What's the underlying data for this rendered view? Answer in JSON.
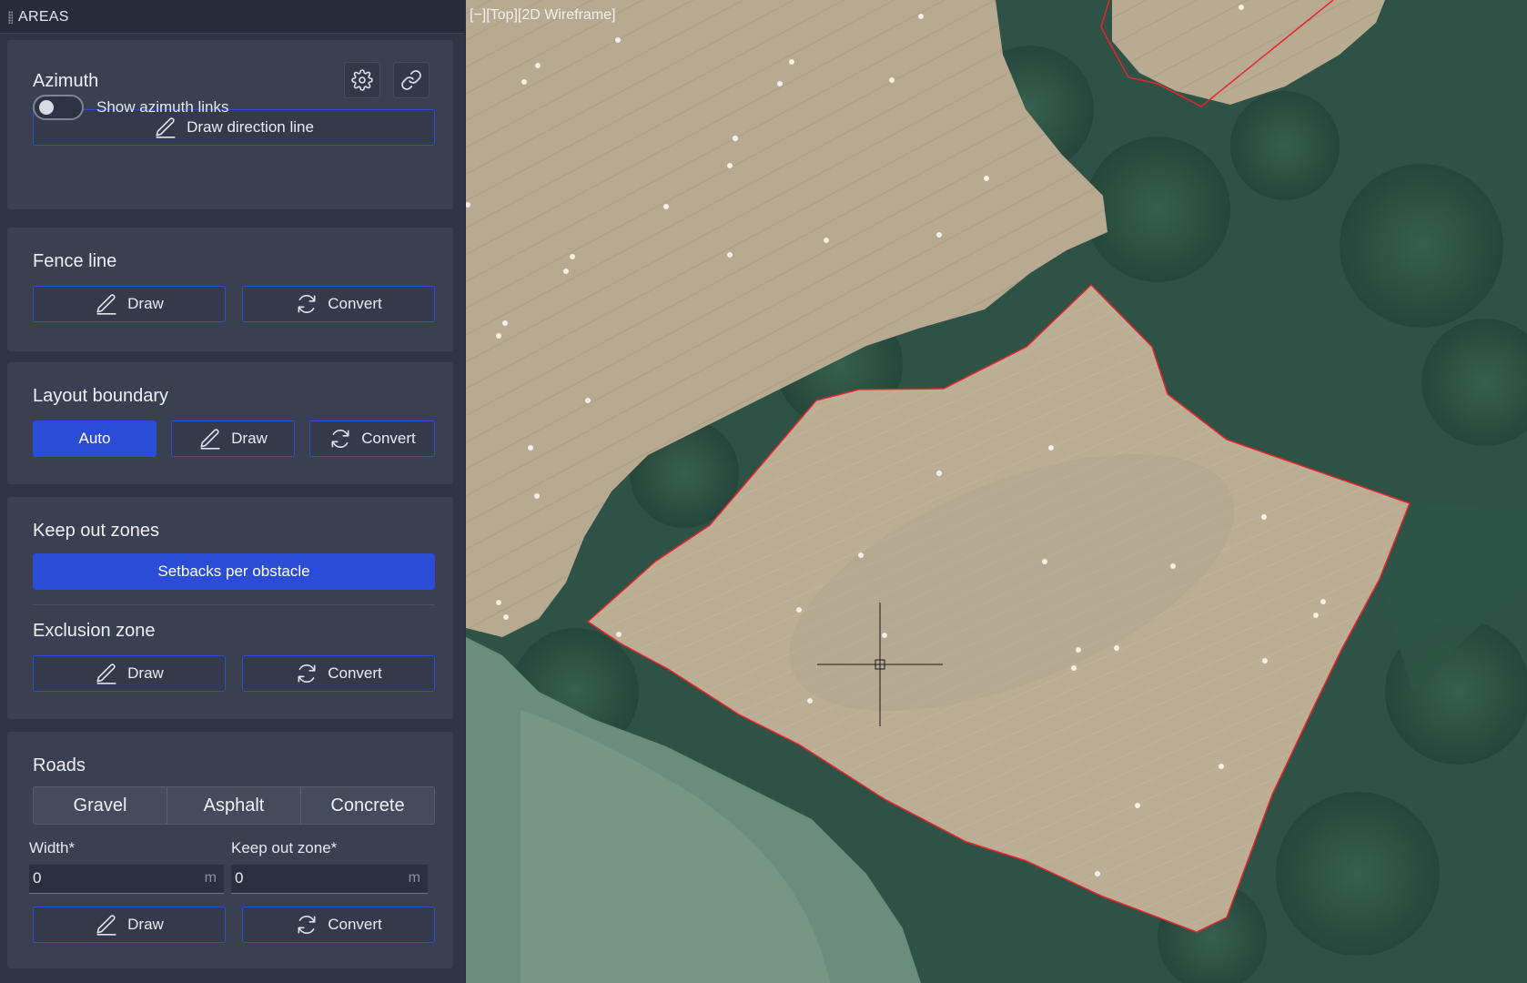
{
  "panel": {
    "title": "AREAS"
  },
  "azimuth": {
    "title": "Azimuth",
    "settings_icon": "gear-icon",
    "link_icon": "link-icon",
    "draw_direction_label": "Draw direction line",
    "show_links_label": "Show azimuth links",
    "show_links_on": false
  },
  "fence_line": {
    "title": "Fence line",
    "draw_label": "Draw",
    "convert_label": "Convert"
  },
  "layout_boundary": {
    "title": "Layout boundary",
    "auto_label": "Auto",
    "draw_label": "Draw",
    "convert_label": "Convert"
  },
  "keep_out": {
    "title": "Keep out zones",
    "setbacks_label": "Setbacks per obstacle",
    "exclusion_title": "Exclusion zone",
    "draw_label": "Draw",
    "convert_label": "Convert"
  },
  "roads": {
    "title": "Roads",
    "types": [
      "Gravel",
      "Asphalt",
      "Concrete"
    ],
    "width_label": "Width*",
    "width_value": "0",
    "width_unit": "m",
    "keepout_label": "Keep out zone*",
    "keepout_value": "0",
    "keepout_unit": "m",
    "draw_label": "Draw",
    "convert_label": "Convert"
  },
  "viewport": {
    "label": "[−][Top][2D Wireframe]",
    "boundary_color": "#e8252b",
    "icons": {
      "draw": "pencil-icon",
      "convert": "refresh-icon"
    }
  }
}
